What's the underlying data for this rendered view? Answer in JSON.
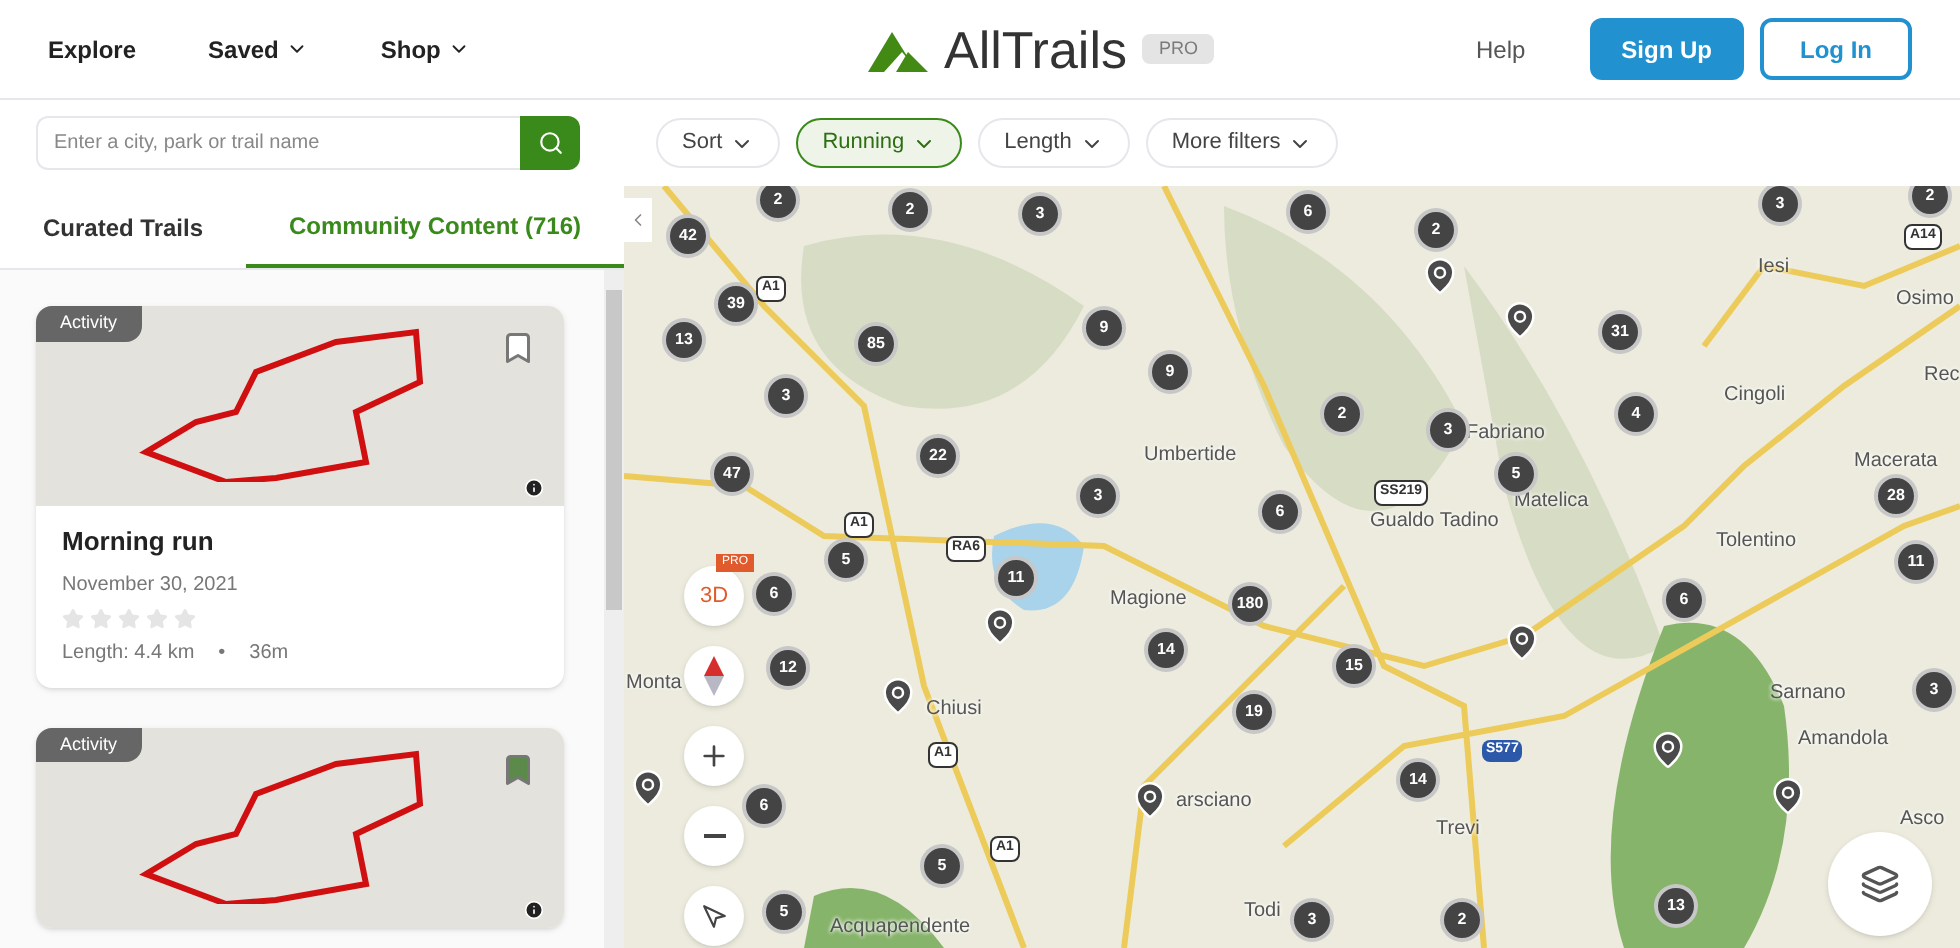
{
  "header": {
    "nav": [
      {
        "label": "Explore",
        "dropdown": false
      },
      {
        "label": "Saved",
        "dropdown": true
      },
      {
        "label": "Shop",
        "dropdown": true
      }
    ],
    "logo": "AllTrails",
    "logo_badge": "PRO",
    "help": "Help",
    "sign_up": "Sign Up",
    "log_in": "Log In"
  },
  "search": {
    "placeholder": "Enter a city, park or trail name"
  },
  "filters": [
    {
      "label": "Sort",
      "selected": false
    },
    {
      "label": "Running",
      "selected": true
    },
    {
      "label": "Length",
      "selected": false
    },
    {
      "label": "More filters",
      "selected": false
    }
  ],
  "tabs": [
    {
      "label": "Curated Trails",
      "selected": false
    },
    {
      "label": "Community Content (716)",
      "selected": true
    }
  ],
  "cards": [
    {
      "badge": "Activity",
      "title": "Morning run",
      "date": "November 30, 2021",
      "stars": 0,
      "length": "Length: 4.4 km",
      "separator": "•",
      "duration": "36m",
      "bookmarked": false
    },
    {
      "badge": "Activity",
      "bookmarked": true
    }
  ],
  "map": {
    "clusters": [
      "2",
      "2",
      "3",
      "6",
      "2",
      "3",
      "2",
      "42",
      "39",
      "13",
      "85",
      "9",
      "9",
      "31",
      "3",
      "2",
      "3",
      "4",
      "22",
      "47",
      "3",
      "5",
      "6",
      "28",
      "5",
      "6",
      "11",
      "11",
      "180",
      "14",
      "15",
      "6",
      "12",
      "19",
      "3",
      "14",
      "6",
      "5",
      "5",
      "3",
      "2",
      "13"
    ],
    "places": [
      "Umbertide",
      "Magione",
      "Chiusi",
      "arsciano",
      "Todi",
      "Acquapendente",
      "Iesi",
      "Osimo",
      "Rec",
      "Cingoli",
      "Fabriano",
      "Matelica",
      "Macerata",
      "Gualdo Tadino",
      "Tolentino",
      "Sarnano",
      "Amandola",
      "Trevi",
      "Asco",
      "Monta"
    ],
    "road_shields": [
      {
        "label": "A1",
        "kind": "motorway"
      },
      {
        "label": "A1",
        "kind": "motorway"
      },
      {
        "label": "RA6",
        "kind": "motorway"
      },
      {
        "label": "A1",
        "kind": "motorway"
      },
      {
        "label": "A1",
        "kind": "motorway"
      },
      {
        "label": "SS219",
        "kind": "motorway"
      },
      {
        "label": "S577",
        "kind": "state"
      },
      {
        "label": "A14",
        "kind": "motorway"
      }
    ],
    "three_d": "3D",
    "three_d_badge": "PRO"
  }
}
